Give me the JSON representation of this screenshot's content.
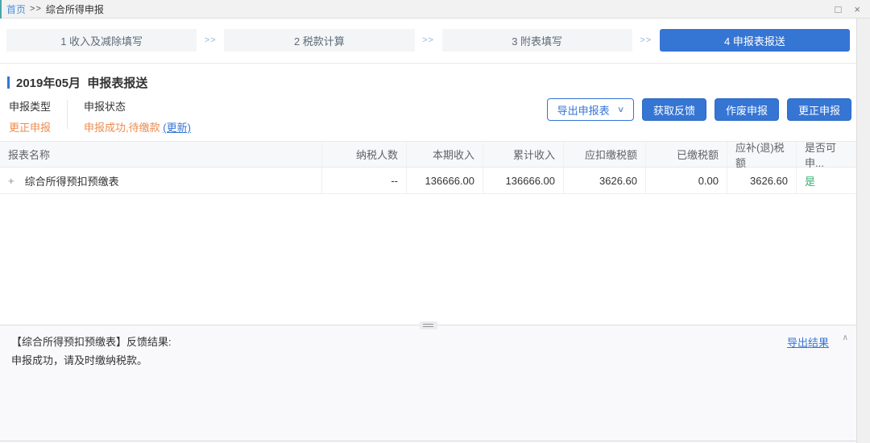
{
  "colors": {
    "accent": "#3575d4",
    "warning_orange": "#ee8b4e",
    "success_green": "#36b072",
    "link_blue": "#4a90d9"
  },
  "icons": {
    "chevron_down": "∨",
    "chevron_up": "∧",
    "maximize": "□",
    "close": "×",
    "plus": "+"
  },
  "breadcrumb": {
    "home": "首页",
    "separator": ">>",
    "current": "综合所得申报"
  },
  "steps": {
    "separator": ">>",
    "items": [
      {
        "label": "1 收入及减除填写"
      },
      {
        "label": "2 税款计算"
      },
      {
        "label": "3 附表填写"
      },
      {
        "label": "4 申报表报送"
      }
    ]
  },
  "section": {
    "title": "2019年05月  申报表报送"
  },
  "declaration_info": {
    "type_label": "申报类型",
    "type_value": "更正申报",
    "status_label": "申报状态",
    "status_value": "申报成功,待缴款 ",
    "update_link": "(更新)"
  },
  "toolbar": {
    "export_label": "导出申报表",
    "feedback_label": "获取反馈",
    "void_label": "作废申报",
    "correct_label": "更正申报"
  },
  "table": {
    "columns": [
      "报表名称",
      "纳税人数",
      "本期收入",
      "累计收入",
      "应扣缴税额",
      "已缴税额",
      "应补(退)税额",
      "是否可申..."
    ],
    "rows": [
      {
        "name": "综合所得预扣预缴表",
        "taxpayer_count": "--",
        "current_income": "136666.00",
        "cumulative_income": "136666.00",
        "withholding_tax": "3626.60",
        "paid_tax": "0.00",
        "supplement_refund_tax": "3626.60",
        "declarable": "是"
      }
    ]
  },
  "feedback_panel": {
    "title": "【综合所得预扣预缴表】反馈结果:",
    "message": "申报成功，请及时缴纳税款。",
    "export_link": "导出结果"
  }
}
